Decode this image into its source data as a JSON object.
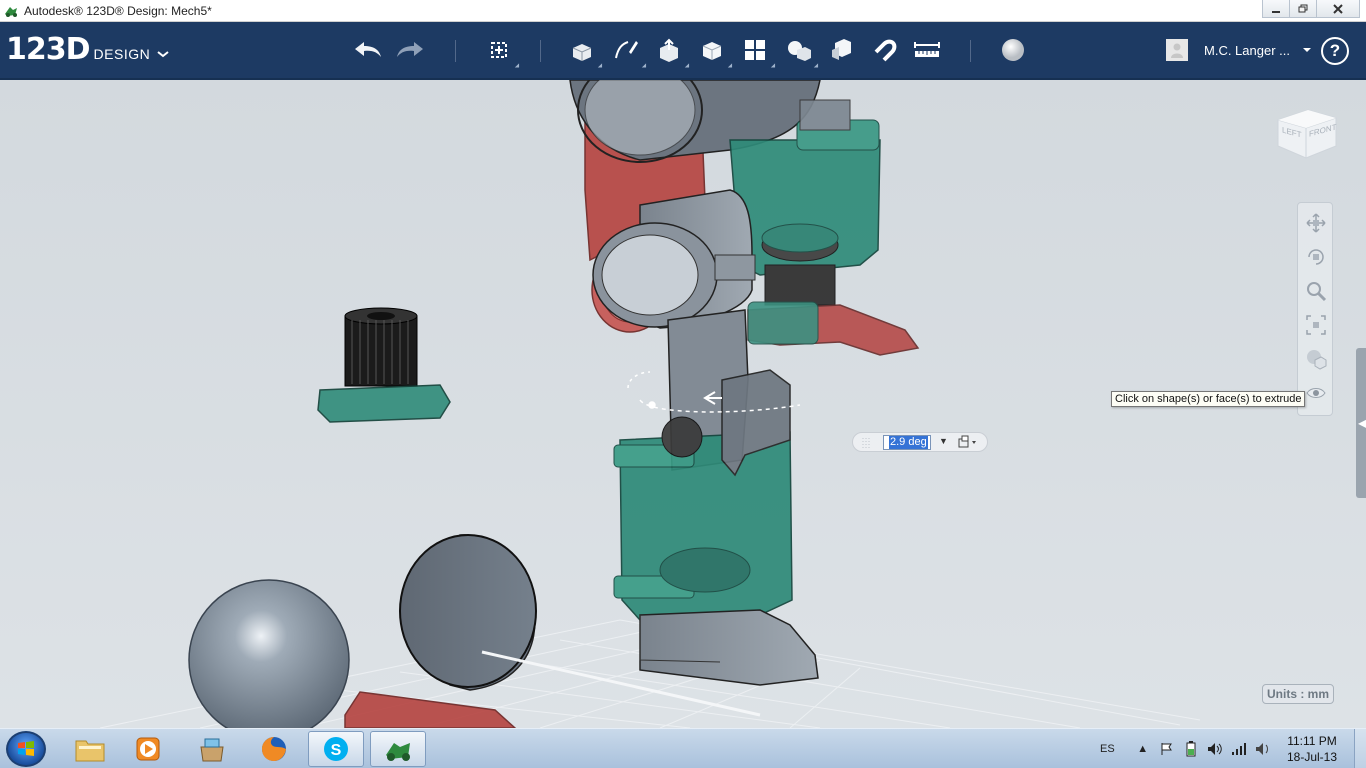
{
  "window": {
    "title": "Autodesk® 123D® Design: Mech5*",
    "controls": [
      "minimize",
      "maximize",
      "close"
    ]
  },
  "toolbar": {
    "logo_number": "123D",
    "logo_word": "DESIGN",
    "logo_menu_icon": "chevron-down-icon",
    "tools": [
      {
        "name": "undo",
        "icon": "undo-arrow-icon"
      },
      {
        "name": "redo",
        "icon": "redo-arrow-icon"
      },
      {
        "name": "transform",
        "icon": "move-gizmo-icon"
      },
      {
        "name": "primitives",
        "icon": "box-icon"
      },
      {
        "name": "sketch",
        "icon": "sketch-pencil-icon"
      },
      {
        "name": "construct",
        "icon": "extrude-icon"
      },
      {
        "name": "modify",
        "icon": "modify-cube-icon"
      },
      {
        "name": "pattern",
        "icon": "pattern-grid-icon"
      },
      {
        "name": "grouping",
        "icon": "group-icon"
      },
      {
        "name": "combine",
        "icon": "combine-icon"
      },
      {
        "name": "snap",
        "icon": "magnet-icon"
      },
      {
        "name": "measure",
        "icon": "ruler-icon"
      },
      {
        "name": "material",
        "icon": "material-sphere-icon"
      }
    ],
    "user_name": "M.C. Langer ...",
    "help_label": "?"
  },
  "viewport": {
    "viewcube": {
      "left_label": "LEFT",
      "front_label": "FRONT"
    },
    "nav_tools": [
      "pan-icon",
      "orbit-icon",
      "zoom-icon",
      "fit-icon",
      "view-mode-icon",
      "visibility-eye-icon"
    ],
    "tooltip": "Click on shape(s) or face(s) to extrude",
    "angle_input_value": "2.9 deg",
    "units_label": "Units : mm"
  },
  "taskbar": {
    "start_icon": "windows-logo-icon",
    "pinned": [
      "file-explorer-icon",
      "media-player-icon",
      "downloads-box-icon",
      "firefox-icon",
      "skype-icon",
      "123d-design-app-icon"
    ],
    "language": "ES",
    "time": "11:11 PM",
    "date": "18-Jul-13"
  },
  "colors": {
    "toolbar_bg": "#1d3a63",
    "viewport_bg": "#d6dce1",
    "part_red": "#b3403c",
    "part_teal": "#2f8a78",
    "part_gray": "#7d8790",
    "part_black": "#1c1c1c"
  }
}
